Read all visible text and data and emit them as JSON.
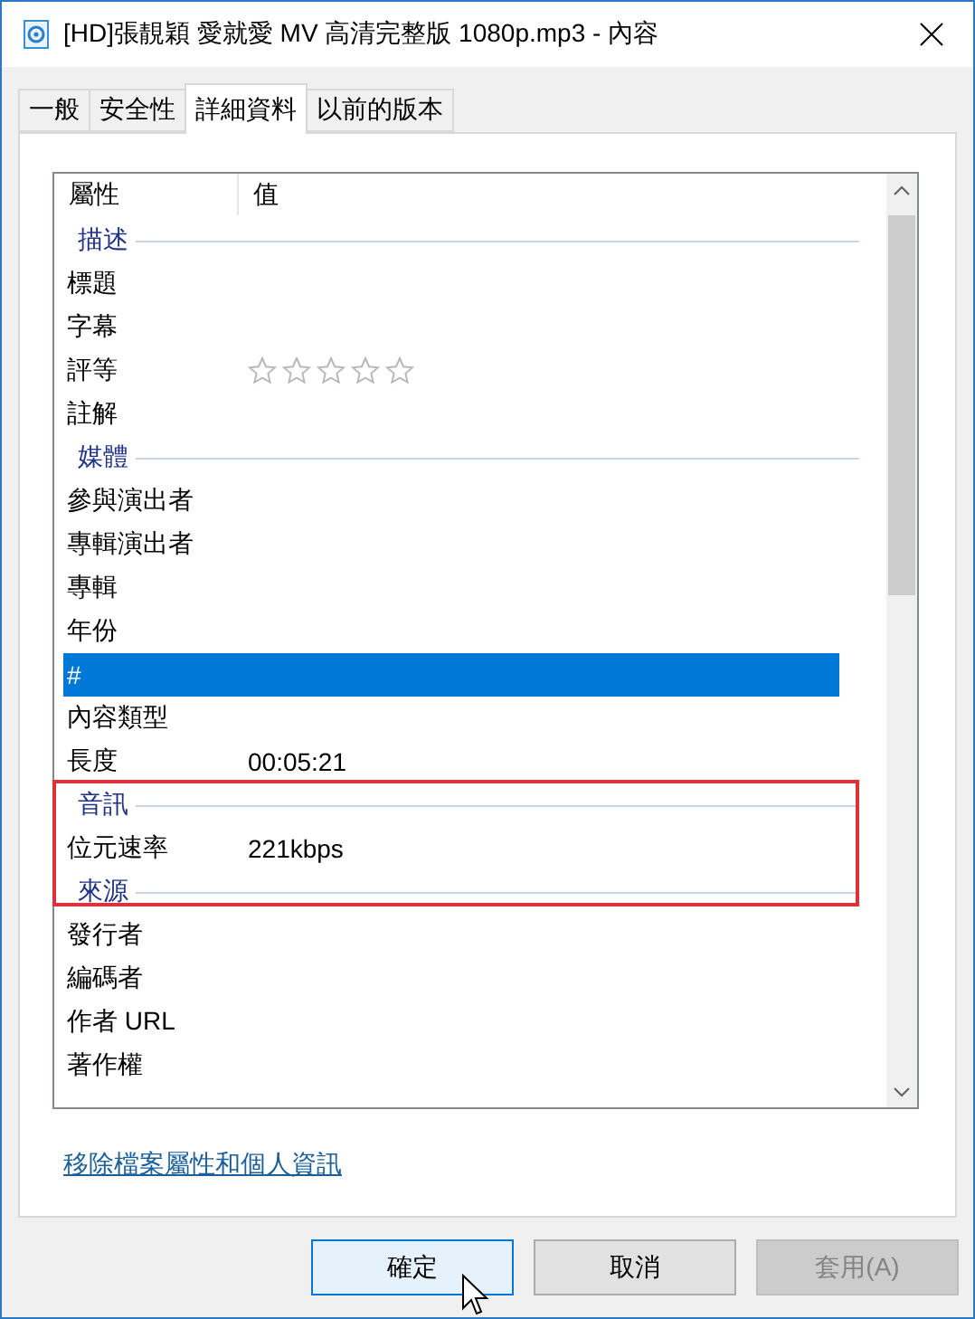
{
  "window": {
    "title": "[HD]張靚穎 愛就愛 MV 高清完整版 1080p.mp3 - 內容"
  },
  "tabs": [
    {
      "label": "一般",
      "selected": false
    },
    {
      "label": "安全性",
      "selected": false
    },
    {
      "label": "詳細資料",
      "selected": true
    },
    {
      "label": "以前的版本",
      "selected": false
    }
  ],
  "list": {
    "columns": [
      "屬性",
      "值"
    ],
    "groups": [
      {
        "label": "描述",
        "highlighted": false,
        "rows": [
          {
            "kind": "text",
            "property": "標題",
            "selected": false
          },
          {
            "kind": "text",
            "property": "字幕",
            "selected": false
          },
          {
            "kind": "stars",
            "property": "評等",
            "stars": 0,
            "selected": false
          },
          {
            "kind": "text",
            "property": "註解",
            "selected": false
          }
        ]
      },
      {
        "label": "媒體",
        "highlighted": false,
        "rows": [
          {
            "kind": "text",
            "property": "參與演出者",
            "selected": false
          },
          {
            "kind": "text",
            "property": "專輯演出者",
            "selected": false
          },
          {
            "kind": "text",
            "property": "專輯",
            "selected": false
          },
          {
            "kind": "text",
            "property": "年份",
            "selected": false
          },
          {
            "kind": "text",
            "property": "#",
            "selected": true
          },
          {
            "kind": "text",
            "property": "內容類型",
            "selected": false
          },
          {
            "kind": "text",
            "property": "長度",
            "value": "00:05:21",
            "selected": false
          }
        ]
      },
      {
        "label": "音訊",
        "highlighted": true,
        "rows": [
          {
            "kind": "text",
            "property": "位元速率",
            "value": "221kbps",
            "selected": false
          }
        ]
      },
      {
        "label": "來源",
        "highlighted": false,
        "rows": [
          {
            "kind": "text",
            "property": "發行者",
            "selected": false
          },
          {
            "kind": "text",
            "property": "編碼者",
            "selected": false
          },
          {
            "kind": "text",
            "property": "作者 URL",
            "selected": false
          },
          {
            "kind": "text",
            "property": "著作權",
            "selected": false
          }
        ]
      }
    ]
  },
  "link": "移除檔案屬性和個人資訊",
  "buttons": [
    {
      "label": "確定",
      "focused": true,
      "disabled": false
    },
    {
      "label": "取消",
      "focused": false,
      "disabled": false
    },
    {
      "label": "套用(A)",
      "focused": false,
      "disabled": true
    }
  ]
}
